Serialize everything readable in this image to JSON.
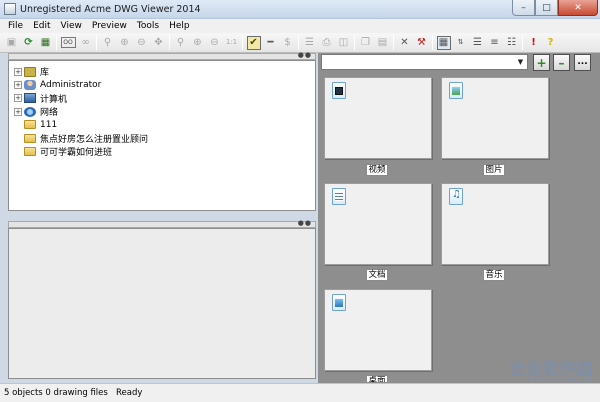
{
  "window": {
    "title": "Unregistered Acme DWG Viewer 2014",
    "min": "–",
    "max": "□",
    "close": "✕"
  },
  "menu": [
    "File",
    "Edit",
    "View",
    "Preview",
    "Tools",
    "Help"
  ],
  "toolbar": {
    "oo_label": "OO",
    "scale_label": "1:1"
  },
  "tree": {
    "items": [
      {
        "label": "库",
        "icon": "library-icon",
        "expand": "+"
      },
      {
        "label": "Administrator",
        "icon": "user-folder-icon",
        "expand": "+"
      },
      {
        "label": "计算机",
        "icon": "computer-icon",
        "expand": "+"
      },
      {
        "label": "网络",
        "icon": "network-icon",
        "expand": "+"
      },
      {
        "label": "111",
        "icon": "folder-icon",
        "expand": ""
      },
      {
        "label": "焦点好房怎么注册置业顾问",
        "icon": "folder-icon",
        "expand": ""
      },
      {
        "label": "可可学霸如何进班",
        "icon": "folder-icon",
        "expand": ""
      }
    ]
  },
  "path": {
    "value": "",
    "arrow": "▼"
  },
  "buttons": {
    "add": "+",
    "remove": "–",
    "more": "..."
  },
  "thumbnails": [
    {
      "label": "视频",
      "icon": "video-icon"
    },
    {
      "label": "图片",
      "icon": "pictures-icon"
    },
    {
      "label": "文档",
      "icon": "documents-icon"
    },
    {
      "label": "音乐",
      "icon": "music-icon"
    },
    {
      "label": "桌面",
      "icon": "desktop-icon"
    }
  ],
  "status": {
    "objects": "5 objects 0 drawing files",
    "state": "Ready"
  },
  "watermark": {
    "text": "合众软件园",
    "url": "www.hezhong.net"
  },
  "colors": {
    "workspace": "#8e8e8e",
    "thumb_bg": "#f0f0f0",
    "add_button": "#2e8b2e",
    "remove_button": "#2e8b2e"
  }
}
